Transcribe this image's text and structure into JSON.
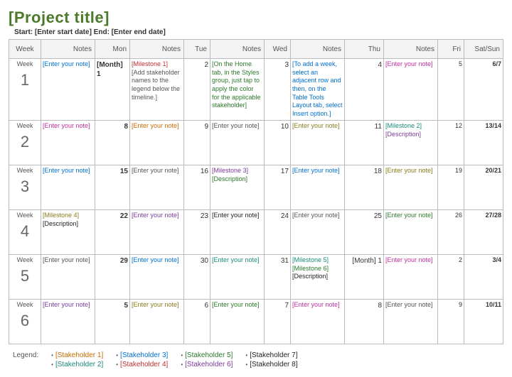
{
  "title": "[Project title]",
  "subtitle": "Start: [Enter start date] End: [Enter end date]",
  "weekLabel": "Week",
  "legendLabel": "Legend:",
  "headers": {
    "notes": "Notes",
    "mon": "Mon",
    "tue": "Tue",
    "wed": "Wed",
    "thu": "Thu",
    "fri": "Fri",
    "satsun": "Sat/Sun"
  },
  "weeks": [
    {
      "num": "1",
      "notes": [
        {
          "text": "[Enter your note]",
          "color": "c-blue"
        }
      ],
      "mon": "[Month] 1",
      "monNotes": [
        {
          "text": "[Milestone 1]",
          "color": "c-red"
        },
        {
          "text": "[Add stakeholder names to the legend below the timeline.]",
          "color": "c-gray"
        }
      ],
      "tue": "2",
      "tueNotes": [
        {
          "text": "[On the Home tab, in the Styles group, just tap to apply the color for the applicable stakeholder]",
          "color": "c-green"
        }
      ],
      "wed": "3",
      "wedNotes": [
        {
          "text": "[To add a week, select an adjacent row and then, on the Table Tools Layout tab, select Insert option.]",
          "color": "c-blue"
        }
      ],
      "thu": "4",
      "thuNotes": [
        {
          "text": "[Enter your note]",
          "color": "c-magenta"
        }
      ],
      "fri": "5",
      "sat": "6/7"
    },
    {
      "num": "2",
      "notes": [
        {
          "text": "[Enter your note]",
          "color": "c-magenta"
        }
      ],
      "mon": "8",
      "monNotes": [
        {
          "text": "[Enter your note]",
          "color": "c-orange"
        }
      ],
      "tue": "9",
      "tueNotes": [
        {
          "text": "[Enter your note]",
          "color": "c-gray"
        }
      ],
      "wed": "10",
      "wedNotes": [
        {
          "text": "[Enter your note]",
          "color": "c-olive"
        }
      ],
      "thu": "11",
      "thuNotes": [
        {
          "text": "[Milestone 2]",
          "color": "c-teal"
        },
        {
          "text": "[Description]",
          "color": "c-purple"
        }
      ],
      "fri": "12",
      "sat": "13/14"
    },
    {
      "num": "3",
      "notes": [
        {
          "text": "[Enter your note]",
          "color": "c-blue"
        }
      ],
      "mon": "15",
      "monNotes": [
        {
          "text": "[Enter your note]",
          "color": "c-gray"
        }
      ],
      "tue": "16",
      "tueNotes": [
        {
          "text": "[Milestone 3]",
          "color": "c-purple"
        },
        {
          "text": "[Description]",
          "color": "c-green"
        }
      ],
      "wed": "17",
      "wedNotes": [
        {
          "text": "[Enter your note]",
          "color": "c-blue"
        }
      ],
      "thu": "18",
      "thuNotes": [
        {
          "text": "[Enter your note]",
          "color": "c-olive"
        }
      ],
      "fri": "19",
      "sat": "20/21"
    },
    {
      "num": "4",
      "notes": [
        {
          "text": "[Milestone 4]",
          "color": "c-olive"
        },
        {
          "text": "[Description]",
          "color": "c-black"
        }
      ],
      "mon": "22",
      "monNotes": [
        {
          "text": "[Enter your note]",
          "color": "c-purple"
        }
      ],
      "tue": "23",
      "tueNotes": [
        {
          "text": "[Enter your note]",
          "color": "c-black"
        }
      ],
      "wed": "24",
      "wedNotes": [
        {
          "text": "[Enter your note]",
          "color": "c-gray"
        }
      ],
      "thu": "25",
      "thuNotes": [
        {
          "text": "[Enter your note]",
          "color": "c-green"
        }
      ],
      "fri": "26",
      "sat": "27/28"
    },
    {
      "num": "5",
      "notes": [
        {
          "text": "[Enter your note]",
          "color": "c-gray"
        }
      ],
      "mon": "29",
      "monNotes": [
        {
          "text": "[Enter your note]",
          "color": "c-blue"
        }
      ],
      "tue": "30",
      "tueNotes": [
        {
          "text": "[Enter your note]",
          "color": "c-teal"
        }
      ],
      "wed": "31",
      "wedNotes": [
        {
          "text": "[Milestone 5]",
          "color": "c-teal"
        },
        {
          "text": "[Milestone 6]",
          "color": "c-green"
        },
        {
          "text": "[Description]",
          "color": "c-black"
        }
      ],
      "thu": "[Month] 1",
      "thuNotes": [
        {
          "text": "[Enter your note]",
          "color": "c-magenta"
        }
      ],
      "fri": "2",
      "sat": "3/4"
    },
    {
      "num": "6",
      "notes": [
        {
          "text": "[Enter your note]",
          "color": "c-purple"
        }
      ],
      "mon": "5",
      "monNotes": [
        {
          "text": "[Enter your note]",
          "color": "c-olive"
        }
      ],
      "tue": "6",
      "tueNotes": [
        {
          "text": "[Enter your note]",
          "color": "c-green"
        }
      ],
      "wed": "7",
      "wedNotes": [
        {
          "text": "[Enter your note]",
          "color": "c-magenta"
        }
      ],
      "thu": "8",
      "thuNotes": [
        {
          "text": "[Enter your note]",
          "color": "c-gray"
        }
      ],
      "fri": "9",
      "sat": "10/11"
    }
  ],
  "legend": [
    [
      {
        "text": "[Stakeholder 1]",
        "color": "c-orange"
      },
      {
        "text": "[Stakeholder 2]",
        "color": "c-teal"
      }
    ],
    [
      {
        "text": "[Stakeholder 3]",
        "color": "c-blue"
      },
      {
        "text": "[Stakeholder 4]",
        "color": "c-red"
      }
    ],
    [
      {
        "text": "[Stakeholder 5]",
        "color": "c-green"
      },
      {
        "text": "[Stakeholder 6]",
        "color": "c-purple"
      }
    ],
    [
      {
        "text": "[Stakeholder 7]",
        "color": "c-black"
      },
      {
        "text": "[Stakeholder 8]",
        "color": "c-black"
      }
    ]
  ]
}
